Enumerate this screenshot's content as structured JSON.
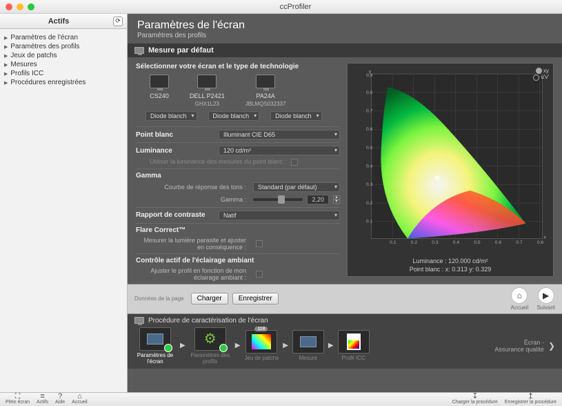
{
  "window": {
    "title": "ccProfiler"
  },
  "sidebar": {
    "header": "Actifs",
    "items": [
      {
        "label": "Paramètres de l'écran"
      },
      {
        "label": "Paramètres des profils"
      },
      {
        "label": "Jeux de patchs"
      },
      {
        "label": "Mesures"
      },
      {
        "label": "Profils ICC"
      },
      {
        "label": "Procédures enregistrées"
      }
    ]
  },
  "header": {
    "title": "Paramètres de l'écran",
    "subtitle": "Paramètres des profils"
  },
  "section": {
    "title": "Mesure par défaut"
  },
  "select_label": "Sélectionner votre écran et le type de technologie",
  "monitors": [
    {
      "name": "CS240",
      "sub": "",
      "tech": "Diode blanch"
    },
    {
      "name": "DELL P2421",
      "sub": "GHX1L23",
      "tech": "Diode blanch"
    },
    {
      "name": "PA24A",
      "sub": "JBLMQS032337",
      "tech": "Diode blanch"
    }
  ],
  "fields": {
    "whitepoint": {
      "label": "Point blanc",
      "value": "Illuminant CIE D65"
    },
    "luminance": {
      "label": "Luminance",
      "value": "120 cd/m²",
      "check_label": "Utiliser la luminance des mesures du point blanc :"
    },
    "gamma": {
      "label": "Gamma",
      "curve_label": "Courbe de réponse des tons :",
      "curve_value": "Standard (par défaut)",
      "gamma_label": "Gamma :",
      "gamma_value": "2,20"
    },
    "contrast": {
      "label": "Rapport de contraste",
      "value": "Natif"
    },
    "flare": {
      "label": "Flare Correct™",
      "check_label": "Mesurer la lumière parasite et ajuster en conséquence :"
    },
    "ambient": {
      "label": "Contrôle actif de l'éclairage ambiant",
      "check_label": "Ajuster le profil en fonction de mon éclairage ambiant :"
    }
  },
  "gamut": {
    "luminance_label": "Luminance : 120.000 cd/m²",
    "whitepoint_label": "Point blanc : x: 0.313  y: 0.329",
    "toggle_xy": "xy",
    "toggle_uv": "u'v'",
    "x_ticks": [
      "0.1",
      "0.2",
      "0.3",
      "0.4",
      "0.5",
      "0.6",
      "0.7",
      "0.8"
    ],
    "y_ticks": [
      "0.1",
      "0.2",
      "0.3",
      "0.4",
      "0.5",
      "0.6",
      "0.7",
      "0.8",
      "0.9"
    ],
    "x_axis": "x",
    "y_axis": "y"
  },
  "chart_data": {
    "type": "area",
    "title": "CIE 1931 xy chromaticity",
    "xlabel": "x",
    "ylabel": "y",
    "xlim": [
      0,
      0.9
    ],
    "ylim": [
      0,
      0.9
    ],
    "white_point": {
      "x": 0.313,
      "y": 0.329
    },
    "luminance_cdm2": 120.0,
    "locus": [
      [
        0.17,
        0.0
      ],
      [
        0.08,
        0.13
      ],
      [
        0.04,
        0.3
      ],
      [
        0.02,
        0.48
      ],
      [
        0.07,
        0.83
      ],
      [
        0.15,
        0.81
      ],
      [
        0.26,
        0.72
      ],
      [
        0.4,
        0.59
      ],
      [
        0.56,
        0.43
      ],
      [
        0.73,
        0.27
      ],
      [
        0.17,
        0.0
      ]
    ]
  },
  "midbar": {
    "pagedata": "Données de la page",
    "load": "Charger",
    "save": "Enregistrer",
    "home": "Accueil",
    "next": "Suivant"
  },
  "workflow": {
    "title": "Procédure de caractérisation de l'écran",
    "steps": [
      {
        "label": "Paramètres de l'écran",
        "done": true,
        "active": true,
        "kind": "monitor"
      },
      {
        "label": "Paramètres des profils",
        "done": true,
        "active": false,
        "kind": "gear"
      },
      {
        "label": "Jeu de patchs",
        "done": false,
        "active": false,
        "badge": "118",
        "kind": "patches"
      },
      {
        "label": "Mesure",
        "done": false,
        "active": false,
        "kind": "monitor"
      },
      {
        "label": "Profil ICC",
        "done": false,
        "active": false,
        "kind": "profile"
      }
    ],
    "extra_label": "Écran -\nAssurance qualité"
  },
  "bottombar": {
    "items_left": [
      {
        "label": "Plein écran",
        "icon": "⛶"
      },
      {
        "label": "Actifs",
        "icon": "≡"
      },
      {
        "label": "Aide",
        "icon": "?"
      },
      {
        "label": "Accueil",
        "icon": "⌂"
      }
    ],
    "items_right": [
      {
        "label": "Charger la procédure",
        "icon": "↧"
      },
      {
        "label": "Enregistrer la procédure",
        "icon": "↥"
      }
    ]
  }
}
